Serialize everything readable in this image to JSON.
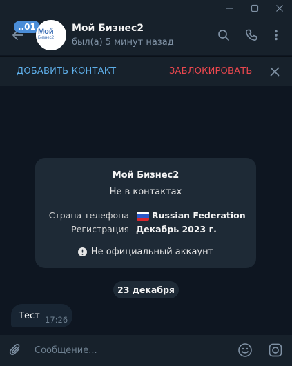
{
  "window": {
    "controls": [
      "minimize-icon",
      "maximize-icon",
      "close-icon"
    ]
  },
  "header": {
    "back_badge": "..01",
    "avatar_text": "Мой Бизнес2",
    "name": "Мой Бизнес2",
    "status": "был(а) 5 минут назад",
    "icons": [
      "search-icon",
      "phone-icon",
      "more-vertical-icon"
    ]
  },
  "action_bar": {
    "add_contact": "ДОБАВИТЬ КОНТАКТ",
    "block": "ЗАБЛОКИРОВАТЬ",
    "block_color": "#e8474e",
    "add_color": "#5eaee8"
  },
  "info_card": {
    "title": "Мой Бизнес2",
    "subtitle": "Не в контактах",
    "phone_country_label": "Страна телефона",
    "phone_country_value": "Russian Federation",
    "registration_label": "Регистрация",
    "registration_value": "Декабрь 2023 г.",
    "note": "Не официальный аккаунт"
  },
  "date_separator": "23 декабря",
  "messages": [
    {
      "text": "Тест",
      "time": "17:26",
      "direction": "incoming"
    }
  ],
  "composer": {
    "placeholder": "Сообщение...",
    "value": "",
    "icons": [
      "paperclip-icon",
      "emoji-icon",
      "camera-icon"
    ]
  },
  "colors": {
    "background": "#0e1621",
    "panel": "#17212b",
    "accent": "#4a8dd8"
  }
}
